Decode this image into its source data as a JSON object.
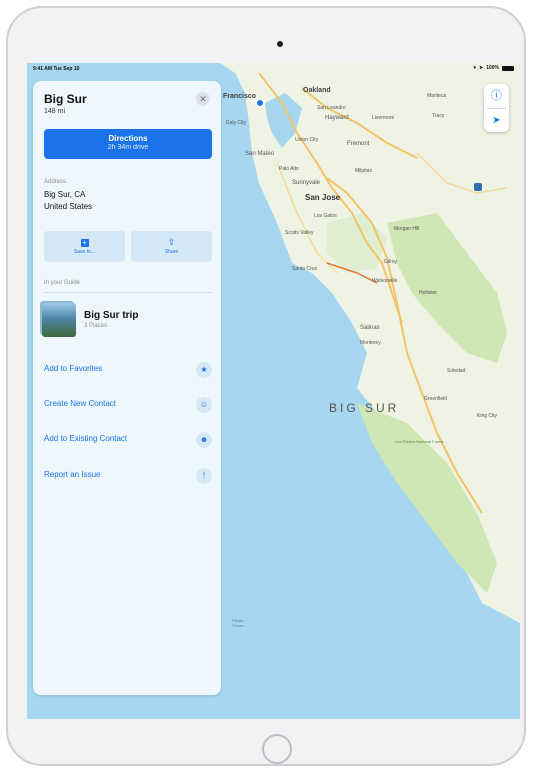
{
  "status_bar": {
    "time": "9:41 AM  Tue Sep 10",
    "battery": "100%"
  },
  "place_card": {
    "title": "Big Sur",
    "distance": "148 mi",
    "close_icon": "close-icon",
    "directions": {
      "label": "Directions",
      "eta": "2h 34m drive",
      "color": "#1a73e8"
    },
    "address": {
      "label": "Address",
      "line1": "Big Sur, CA",
      "line2": "United States"
    },
    "actions": [
      {
        "label": "Save to...",
        "icon": "save-icon"
      },
      {
        "label": "Share",
        "icon": "share-icon"
      }
    ],
    "guide": {
      "section_label": "In your Guide",
      "name": "Big Sur trip",
      "count": "3 Places"
    },
    "menu": [
      {
        "label": "Add to Favorites",
        "icon": "star-icon"
      },
      {
        "label": "Create New Contact",
        "icon": "contact-icon"
      },
      {
        "label": "Add to Existing Contact",
        "icon": "add-contact-icon"
      },
      {
        "label": "Report an Issue",
        "icon": "report-icon"
      }
    ]
  },
  "map": {
    "region_label": "BIG SUR",
    "city_labels": [
      "Francisco",
      "Oakland",
      "Daly City",
      "San Leandro",
      "Hayward",
      "Livermore",
      "Manteca",
      "Tracy",
      "Union City",
      "Fremont",
      "San Mateo",
      "Palo Alto",
      "Milpitas",
      "Sunnyvale",
      "San Jose",
      "Los Gatos",
      "Scotts Valley",
      "Morgan Hill",
      "Santa Cruz",
      "Gilroy",
      "Watsonville",
      "Hollister",
      "Salinas",
      "Monterey",
      "Soledad",
      "Greenfield",
      "King City",
      "Los Padres National Forest",
      "Pacific Ocean"
    ],
    "controls": {
      "info_icon": "info-icon",
      "location_icon": "location-arrow-icon"
    },
    "colors": {
      "water": "#a6d6f0",
      "land": "#eef3e4",
      "park": "#cfe6b5",
      "road": "#f3c36a"
    }
  }
}
